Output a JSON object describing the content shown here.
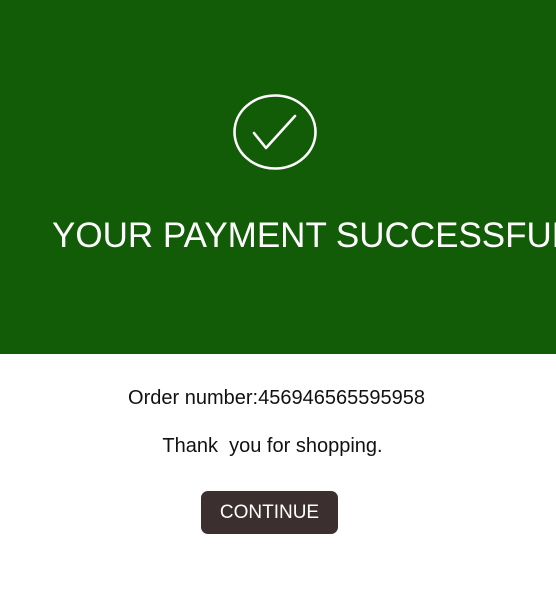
{
  "banner": {
    "icon": "checkmark-circle-icon",
    "title": "YOUR PAYMENT SUCCESSFUL",
    "background_color": "#125b07"
  },
  "order": {
    "label": "Order number:",
    "number": "456946565595958",
    "line": "Order number:456946565595958"
  },
  "thanks": {
    "text": "Thank  you for shopping."
  },
  "actions": {
    "continue_label": "CONTINUE",
    "button_color": "#3b2f2f"
  }
}
